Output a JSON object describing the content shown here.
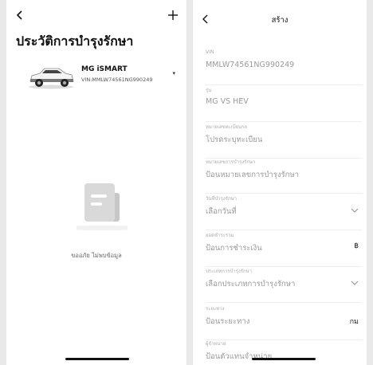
{
  "left": {
    "title": "ประวัติการบำรุงรักษา",
    "vehicle": {
      "model": "MG iSMART",
      "vin": "VIN:MMLW74561NG990249"
    },
    "empty_message": "ขออภัย ไม่พบข้อมูล"
  },
  "right": {
    "title": "สร้าง",
    "fields": [
      {
        "label": "VIN",
        "value": "MMLW74561NG990249"
      },
      {
        "label": "รุ่น",
        "value": "MG VS HEV"
      },
      {
        "label": "หมายเลขทะเบียนรถ",
        "value": "โปรดระบุทะเบียน"
      },
      {
        "label": "หมายเลขการบำรุงรักษา",
        "value": "ป้อนหมายเลขการบำรุงรักษา"
      },
      {
        "label": "วันที่บำรุงรักษา",
        "value": "เลือกวันที่"
      },
      {
        "label": "ยอดชำระรวม",
        "value": "ป้อนการชำระเงิน",
        "suffix": "฿"
      },
      {
        "label": "ประเภทการบำรุงรักษา",
        "value": "เลือกประเภทการบำรุงรักษา"
      },
      {
        "label": "ระยะทาง",
        "value": "ป้อนระยะทาง",
        "suffix": "กม"
      },
      {
        "label": "ผู้จำหน่าย",
        "value": "ป้อนตัวแทนจำหน่าย"
      }
    ]
  }
}
